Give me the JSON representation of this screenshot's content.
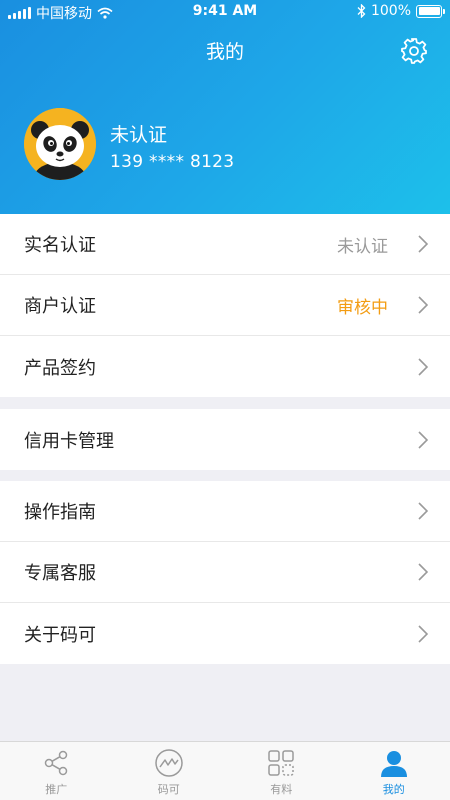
{
  "status_bar": {
    "carrier": "中国移动",
    "time": "9:41 AM",
    "battery": "100%"
  },
  "header": {
    "title": "我的"
  },
  "user": {
    "name": "未认证",
    "phone": "139 **** 8123"
  },
  "menu_group1": [
    {
      "label": "实名认证",
      "value": "未认证"
    },
    {
      "label": "商户认证",
      "value": "审核中"
    },
    {
      "label": "产品签约",
      "value": ""
    }
  ],
  "menu_group2": [
    {
      "label": "信用卡管理"
    }
  ],
  "menu_group3": [
    {
      "label": "操作指南"
    },
    {
      "label": "专属客服"
    },
    {
      "label": "关于码可"
    }
  ],
  "tabs": [
    {
      "label": "推广",
      "icon": "share-icon"
    },
    {
      "label": "码可",
      "icon": "logo-icon"
    },
    {
      "label": "有料",
      "icon": "grid-icon"
    },
    {
      "label": "我的",
      "icon": "person-icon",
      "active": true
    }
  ],
  "colors": {
    "accent": "#1a8fe0",
    "pending": "#f39c12",
    "muted": "#9a9a9a"
  }
}
